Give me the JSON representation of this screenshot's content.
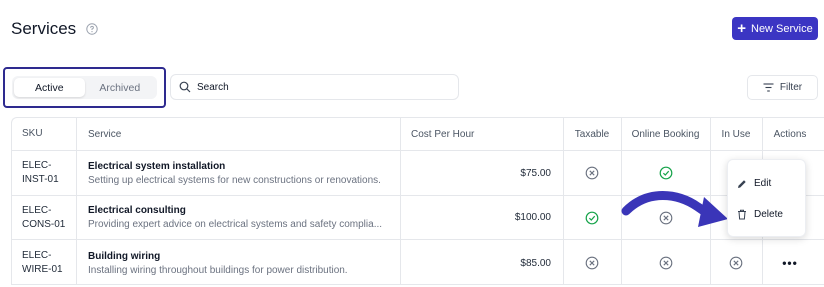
{
  "header": {
    "title": "Services",
    "new_button_label": "New Service"
  },
  "tabs": [
    {
      "label": "Active",
      "active": true
    },
    {
      "label": "Archived",
      "active": false
    }
  ],
  "search": {
    "placeholder": "Search"
  },
  "filter_label": "Filter",
  "table": {
    "columns": [
      "SKU",
      "Service",
      "Cost Per Hour",
      "Taxable",
      "Online Booking",
      "In Use",
      "Actions"
    ],
    "rows": [
      {
        "sku_line1": "ELEC-",
        "sku_line2": "INST-01",
        "name": "Electrical system installation",
        "description": "Setting up electrical systems for new constructions or renovations.",
        "cost": "$75.00",
        "taxable": "x-circle-icon",
        "online": "check-circle-icon",
        "in_use": ""
      },
      {
        "sku_line1": "ELEC-",
        "sku_line2": "CONS-01",
        "name": "Electrical consulting",
        "description": "Providing expert advice on electrical systems and safety complia...",
        "cost": "$100.00",
        "taxable": "check-circle-icon",
        "online": "x-circle-icon",
        "in_use": ""
      },
      {
        "sku_line1": "ELEC-",
        "sku_line2": "WIRE-01",
        "name": "Building wiring",
        "description": "Installing wiring throughout buildings for power distribution.",
        "cost": "$85.00",
        "taxable": "x-circle-icon",
        "online": "x-circle-icon",
        "in_use": "x-circle-icon"
      }
    ]
  },
  "actions_menu": {
    "items": [
      "Edit",
      "Delete"
    ]
  },
  "colors": {
    "primary": "#3b35c3",
    "success": "#16a34a",
    "muted_icon": "#6b7280",
    "annotation_border": "#2e2a8f"
  }
}
